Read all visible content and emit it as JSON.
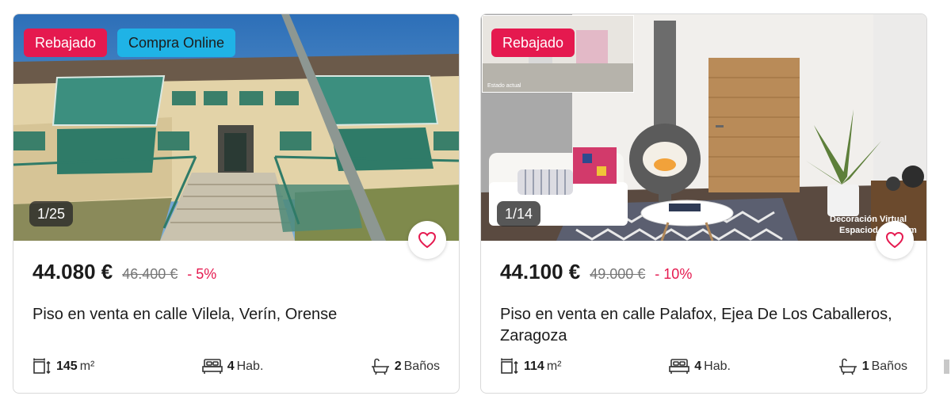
{
  "cards": [
    {
      "badges": [
        "Rebajado",
        "Compra Online"
      ],
      "photo_counter": "1/25",
      "price": "44.080 €",
      "old_price": "46.400 €",
      "discount": "- 5%",
      "title": "Piso en venta en calle Vilela, Verín, Orense",
      "area_value": "145",
      "area_unit": "m²",
      "rooms_value": "4",
      "rooms_label": "Hab.",
      "baths_value": "2",
      "baths_label": "Baños"
    },
    {
      "badges": [
        "Rebajado"
      ],
      "photo_counter": "1/14",
      "photo_watermark": "Decoración Virtual",
      "photo_watermark_2": "Espaciod",
      "photo_watermark_2_tail": "m",
      "inset_label": "Estado actual",
      "price": "44.100 €",
      "old_price": "49.000 €",
      "discount": "- 10%",
      "title": "Piso en venta en calle Palafox, Ejea De Los Caballeros, Zaragoza",
      "area_value": "114",
      "area_unit": "m²",
      "rooms_value": "4",
      "rooms_label": "Hab.",
      "baths_value": "1",
      "baths_label": "Baños"
    }
  ],
  "colors": {
    "accent": "#e5194f",
    "badge_online": "#1fb3e6",
    "text": "#1c1c1c",
    "muted": "#777777"
  },
  "icons": [
    "heart-icon",
    "area-icon",
    "bed-icon",
    "bathtub-icon"
  ]
}
